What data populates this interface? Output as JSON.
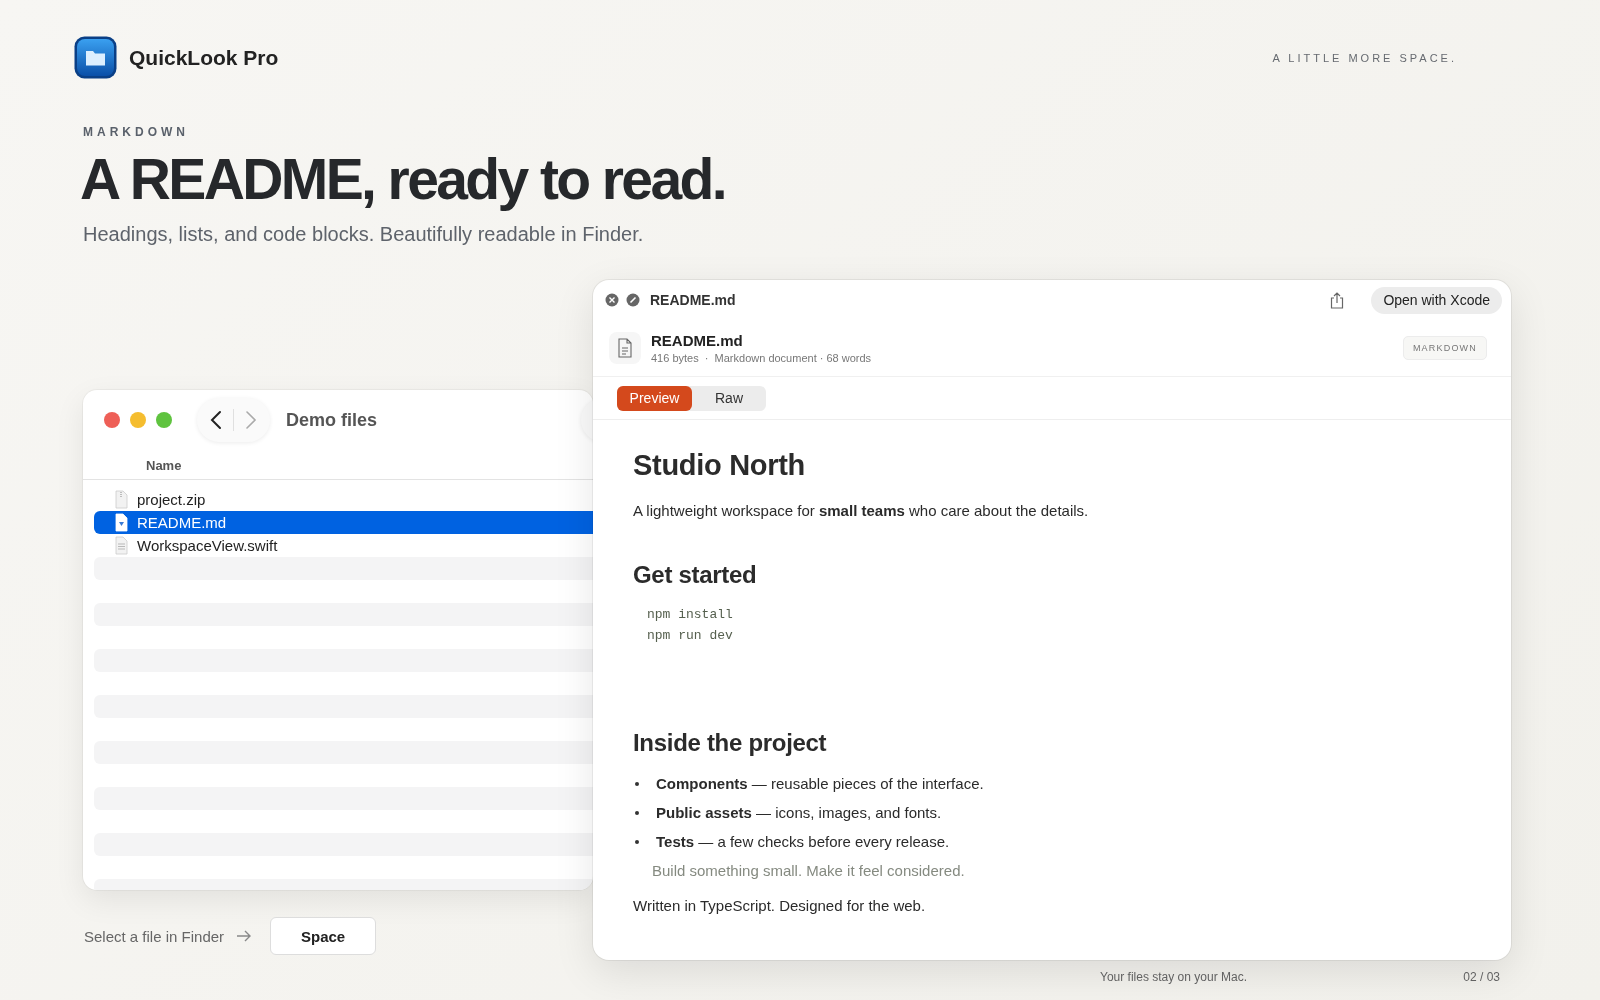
{
  "app": {
    "name": "QuickLook Pro",
    "tagline": "A LITTLE MORE SPACE."
  },
  "hero": {
    "eyebrow": "MARKDOWN",
    "headline": "A README, ready to read.",
    "subtitle": "Headings, lists, and code blocks. Beautifully readable in Finder."
  },
  "finder": {
    "title": "Demo files",
    "column": "Name",
    "files": [
      {
        "name": "project.zip",
        "kind": "zip",
        "selected": false
      },
      {
        "name": "README.md",
        "kind": "markdown",
        "selected": true
      },
      {
        "name": "WorkspaceView.swift",
        "kind": "swift",
        "selected": false
      }
    ]
  },
  "quicklook": {
    "title": "README.md",
    "open_button": "Open with Xcode",
    "file": {
      "name": "README.md",
      "meta": "416 bytes  ·  Markdown document · 68 words",
      "badge": "MARKDOWN"
    },
    "tabs": [
      {
        "label": "Preview",
        "selected": true
      },
      {
        "label": "Raw",
        "selected": false
      }
    ],
    "document": [
      {
        "kind": "h1",
        "text": "Studio North"
      },
      {
        "kind": "p",
        "text": "A lightweight workspace for **small teams** who care about the details."
      },
      {
        "kind": "h2",
        "text": "Get started"
      },
      {
        "kind": "code",
        "lines": [
          "npm install",
          "npm run dev"
        ]
      },
      {
        "kind": "h2",
        "text": "Inside the project"
      },
      {
        "kind": "list",
        "items": [
          "**Components** — reusable pieces of the interface.",
          "**Public assets** — icons, images, and fonts.",
          "**Tests** — a few checks before every release."
        ]
      },
      {
        "kind": "quote",
        "text": "Build something small. Make it feel considered."
      },
      {
        "kind": "p",
        "text": "Written in TypeScript. Designed for the web."
      }
    ]
  },
  "hint": {
    "text": "Select a file in Finder",
    "key": "Space"
  },
  "footer": {
    "note": "Your files stay on your Mac.",
    "page": "02 / 03"
  }
}
